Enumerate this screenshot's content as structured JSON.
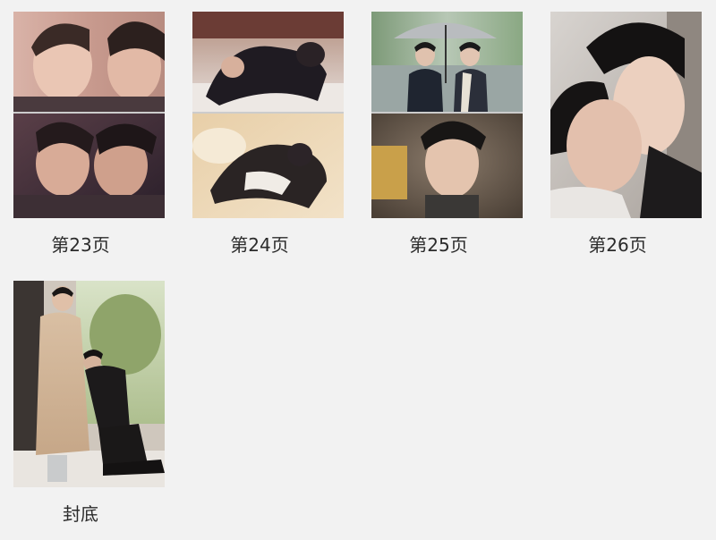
{
  "pages": [
    {
      "label": "第23页",
      "image": "photo-two-men-close-embrace"
    },
    {
      "label": "第24页",
      "image": "photo-men-lying-on-floor"
    },
    {
      "label": "第25页",
      "image": "photo-umbrella-and-portrait"
    },
    {
      "label": "第26页",
      "image": "photo-kiss-closeup"
    },
    {
      "label": "封底",
      "image": "photo-man-kneeling-by-window"
    }
  ]
}
